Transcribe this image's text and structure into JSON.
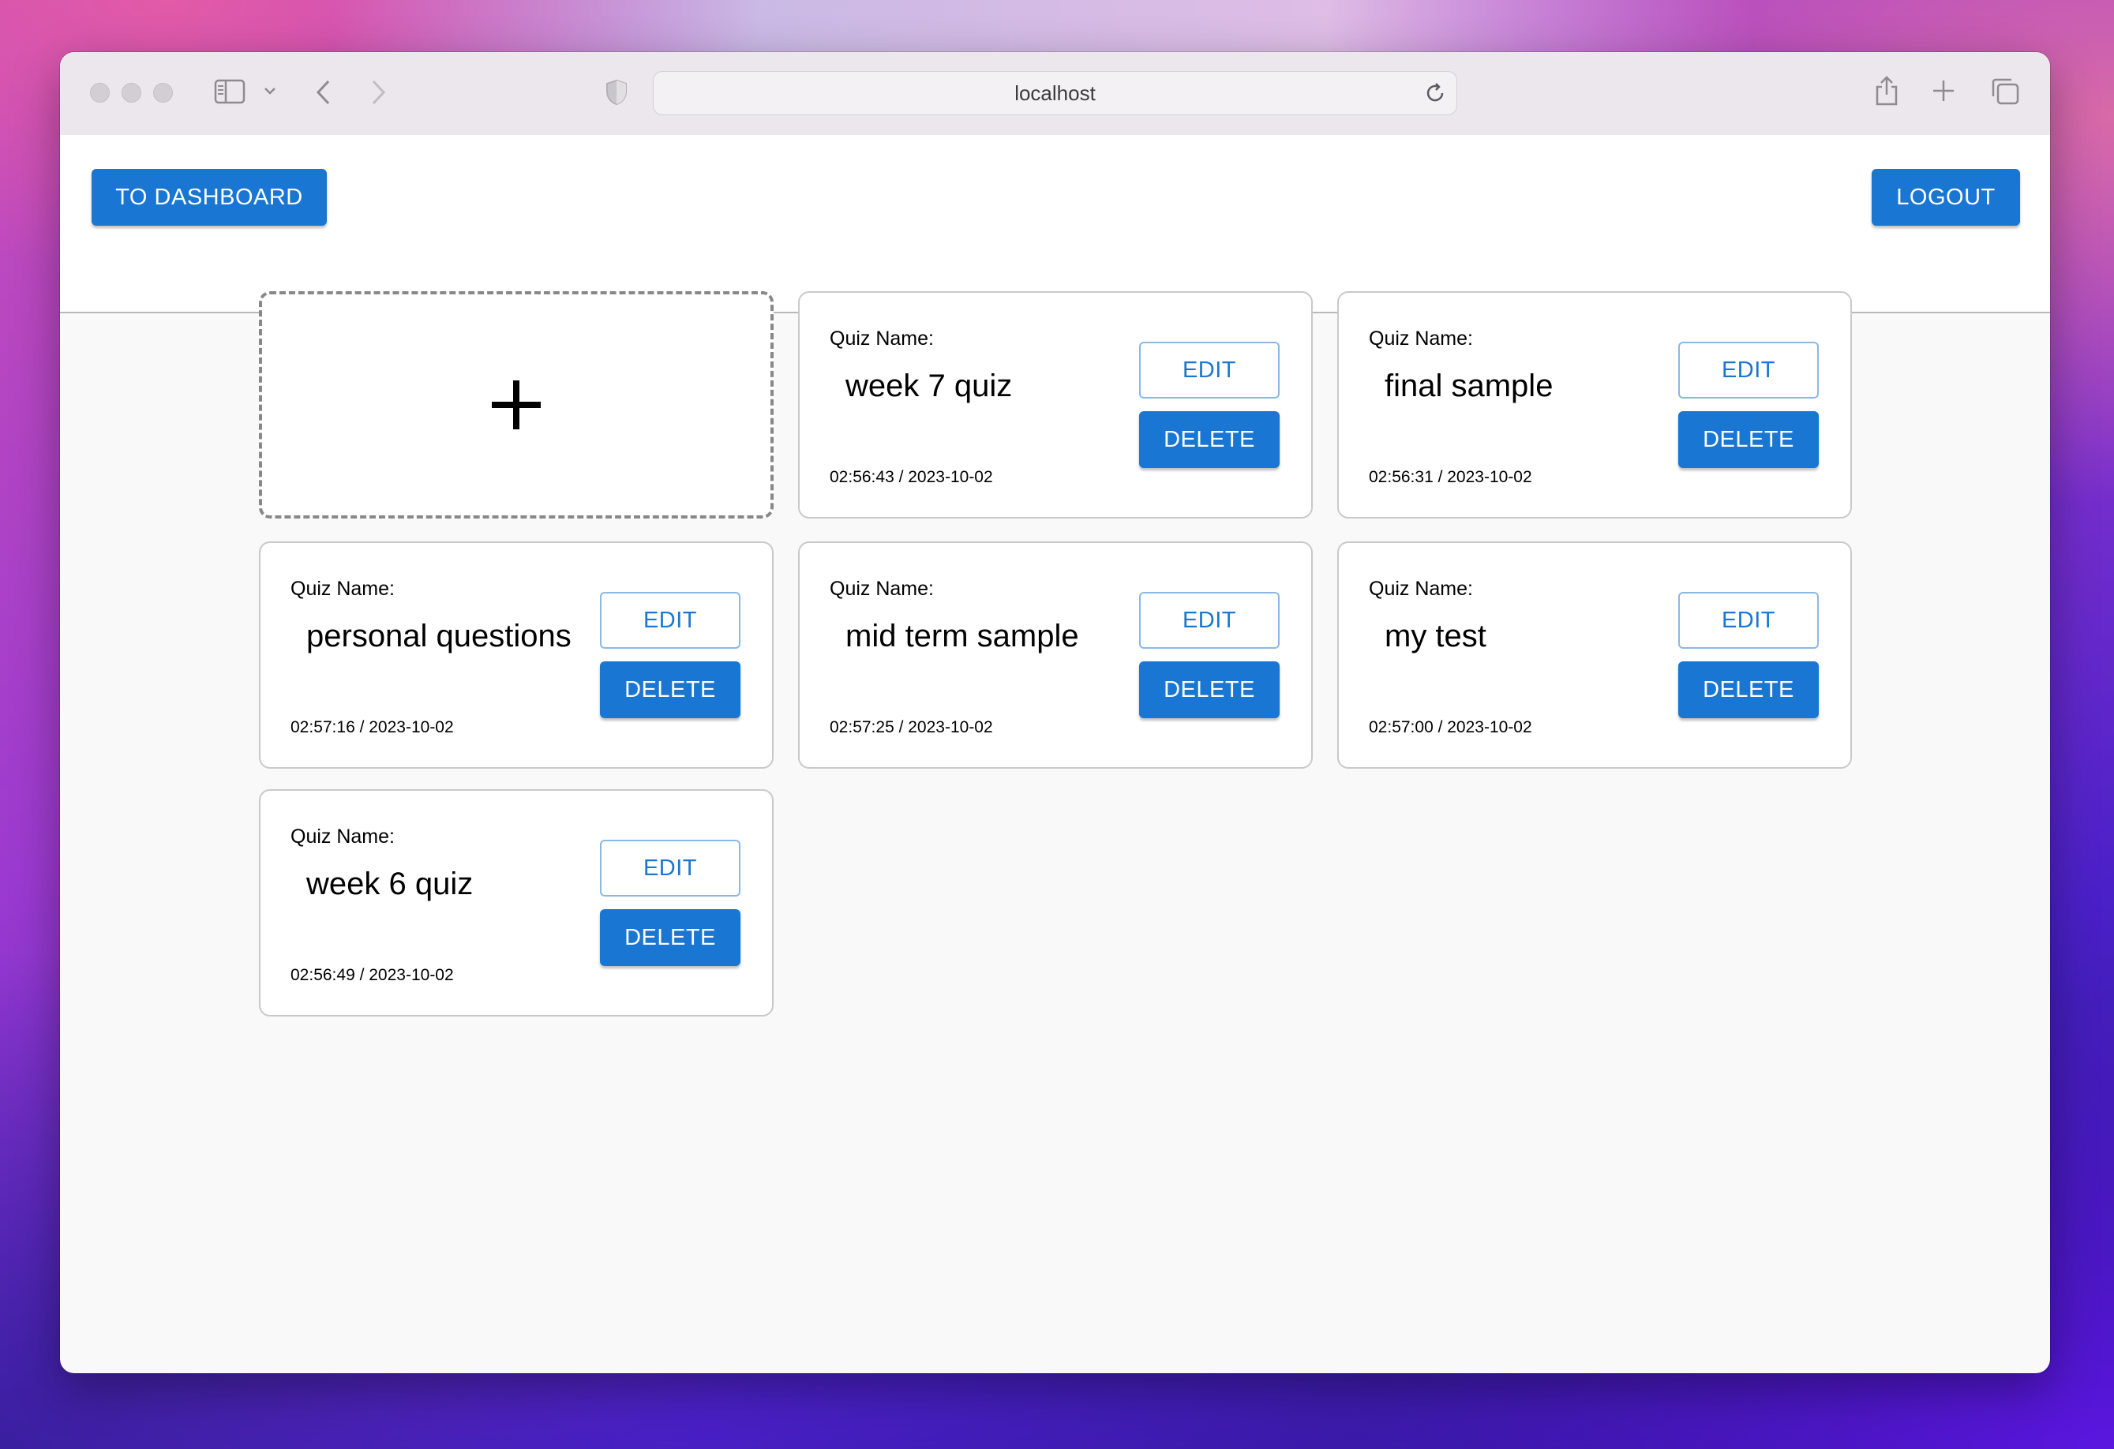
{
  "browser": {
    "url": "localhost"
  },
  "header": {
    "dashboard_button": "TO DASHBOARD",
    "logout_button": "LOGOUT"
  },
  "add_card": {
    "symbol": "+"
  },
  "quizzes": [
    {
      "label": "Quiz Name:",
      "name": "week 7 quiz",
      "timestamp": "02:56:43 / 2023-10-02",
      "edit": "EDIT",
      "delete": "DELETE"
    },
    {
      "label": "Quiz Name:",
      "name": "final sample",
      "timestamp": "02:56:31 / 2023-10-02",
      "edit": "EDIT",
      "delete": "DELETE"
    },
    {
      "label": "Quiz Name:",
      "name": "personal questions",
      "timestamp": "02:57:16 / 2023-10-02",
      "edit": "EDIT",
      "delete": "DELETE"
    },
    {
      "label": "Quiz Name:",
      "name": "mid term sample",
      "timestamp": "02:57:25 / 2023-10-02",
      "edit": "EDIT",
      "delete": "DELETE"
    },
    {
      "label": "Quiz Name:",
      "name": "my test",
      "timestamp": "02:57:00 / 2023-10-02",
      "edit": "EDIT",
      "delete": "DELETE"
    },
    {
      "label": "Quiz Name:",
      "name": "week 6 quiz",
      "timestamp": "02:56:49 / 2023-10-02",
      "edit": "EDIT",
      "delete": "DELETE"
    }
  ],
  "colors": {
    "primary": "#1976d2",
    "page_background": "#f9f9f9"
  },
  "icons": [
    "sidebar-icon",
    "chevron-down-icon",
    "back-icon",
    "forward-icon",
    "shield-icon",
    "reload-icon",
    "share-icon",
    "new-tab-icon",
    "tabs-overview-icon",
    "plus-icon"
  ]
}
